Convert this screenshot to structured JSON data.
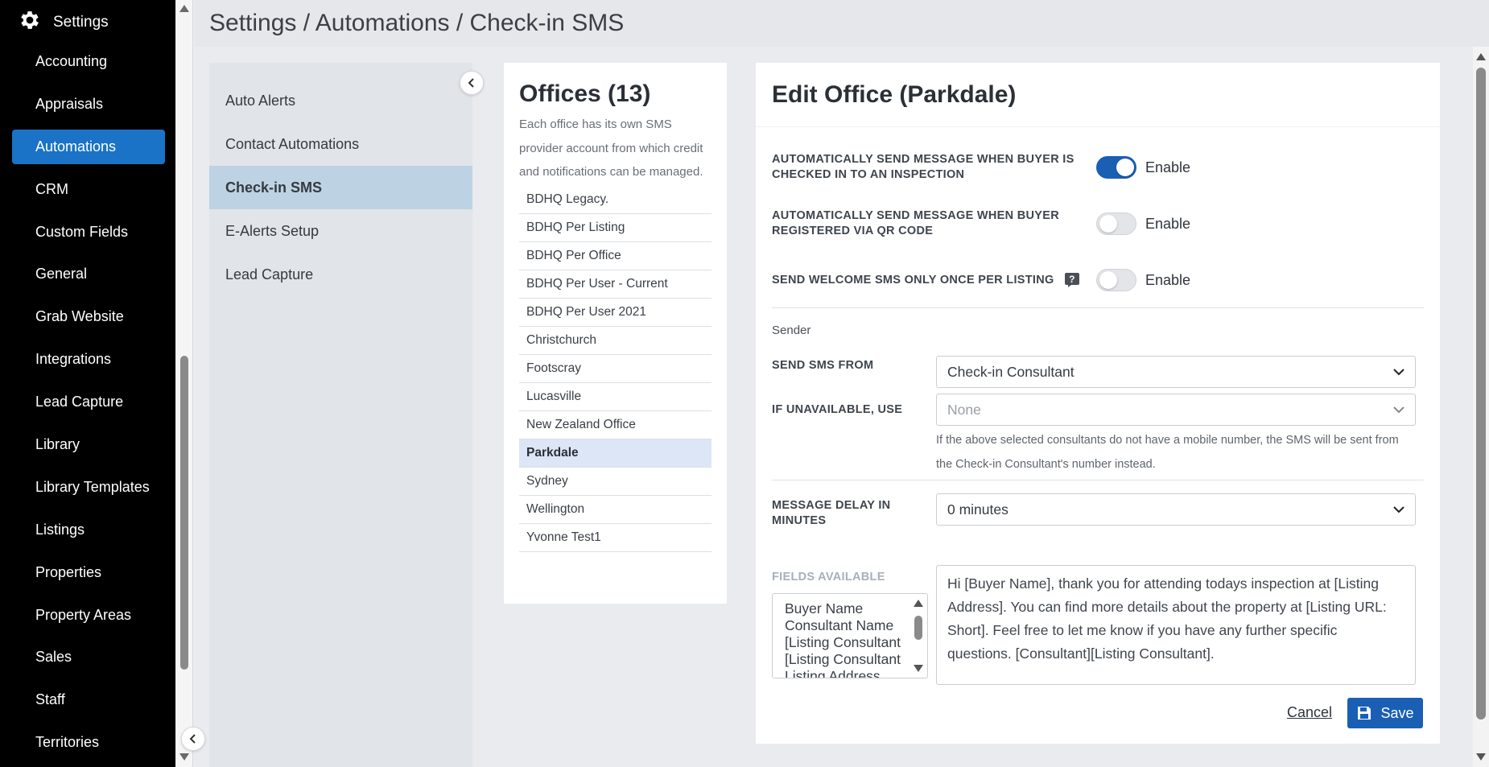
{
  "sidebar": {
    "title": "Settings",
    "items": [
      {
        "label": "Accounting"
      },
      {
        "label": "Appraisals"
      },
      {
        "label": "Automations"
      },
      {
        "label": "CRM"
      },
      {
        "label": "Custom Fields"
      },
      {
        "label": "General"
      },
      {
        "label": "Grab Website"
      },
      {
        "label": "Integrations"
      },
      {
        "label": "Lead Capture"
      },
      {
        "label": "Library"
      },
      {
        "label": "Library Templates"
      },
      {
        "label": "Listings"
      },
      {
        "label": "Properties"
      },
      {
        "label": "Property Areas"
      },
      {
        "label": "Sales"
      },
      {
        "label": "Staff"
      },
      {
        "label": "Territories"
      }
    ],
    "active": "Automations"
  },
  "header": {
    "breadcrumb": "Settings / Automations / Check-in SMS"
  },
  "subnav": {
    "items": [
      {
        "label": "Auto Alerts"
      },
      {
        "label": "Contact Automations"
      },
      {
        "label": "Check-in SMS"
      },
      {
        "label": "E-Alerts Setup"
      },
      {
        "label": "Lead Capture"
      }
    ],
    "active": "Check-in SMS"
  },
  "offices": {
    "title": "Offices (13)",
    "description": "Each office has its own SMS provider account from which credit and notifications can be managed.",
    "items": [
      {
        "label": "BDHQ Legacy."
      },
      {
        "label": "BDHQ Per Listing"
      },
      {
        "label": "BDHQ Per Office"
      },
      {
        "label": "BDHQ Per User - Current"
      },
      {
        "label": "BDHQ Per User 2021"
      },
      {
        "label": "Christchurch"
      },
      {
        "label": "Footscray"
      },
      {
        "label": "Lucasville"
      },
      {
        "label": "New Zealand Office"
      },
      {
        "label": "Parkdale"
      },
      {
        "label": "Sydney"
      },
      {
        "label": "Wellington"
      },
      {
        "label": "Yvonne Test1"
      }
    ],
    "selected": "Parkdale"
  },
  "edit": {
    "title": "Edit Office (Parkdale)",
    "toggles": [
      {
        "label": "Automatically send message when buyer is checked in to an inspection",
        "state": "Enable",
        "on": true
      },
      {
        "label": "Automatically send message when buyer registered via QR code",
        "state": "Enable",
        "on": false
      },
      {
        "label": "Send welcome SMS only once per listing",
        "state": "Enable",
        "on": false
      }
    ],
    "sender_section": "Sender",
    "send_from_label": "SEND SMS FROM",
    "send_from_value": "Check-in Consultant",
    "if_unavailable_label": "IF UNAVAILABLE, USE",
    "if_unavailable_value": "None",
    "hint": "If the above selected consultants do not have a mobile number, the SMS will be sent from the Check-in Consultant's number instead.",
    "delay_label": "MESSAGE DELAY IN MINUTES",
    "delay_value": "0 minutes",
    "fields_label": "FIELDS AVAILABLE",
    "fields": [
      "Buyer Name",
      "Consultant Name",
      "[Listing Consultant",
      "[Listing Consultant",
      "Listing Address"
    ],
    "message": "Hi [Buyer Name], thank you for attending todays inspection at [Listing Address]. You can find more details about the property at [Listing URL: Short]. Feel free to let me know if you have any further specific questions. [Consultant][Listing Consultant].",
    "cancel_label": "Cancel",
    "save_label": "Save"
  },
  "colors": {
    "accent": "#1a73c7",
    "primary_button": "#1a5fb4",
    "subnav_active": "#bdd3e3",
    "office_selected": "#dde6f7"
  }
}
